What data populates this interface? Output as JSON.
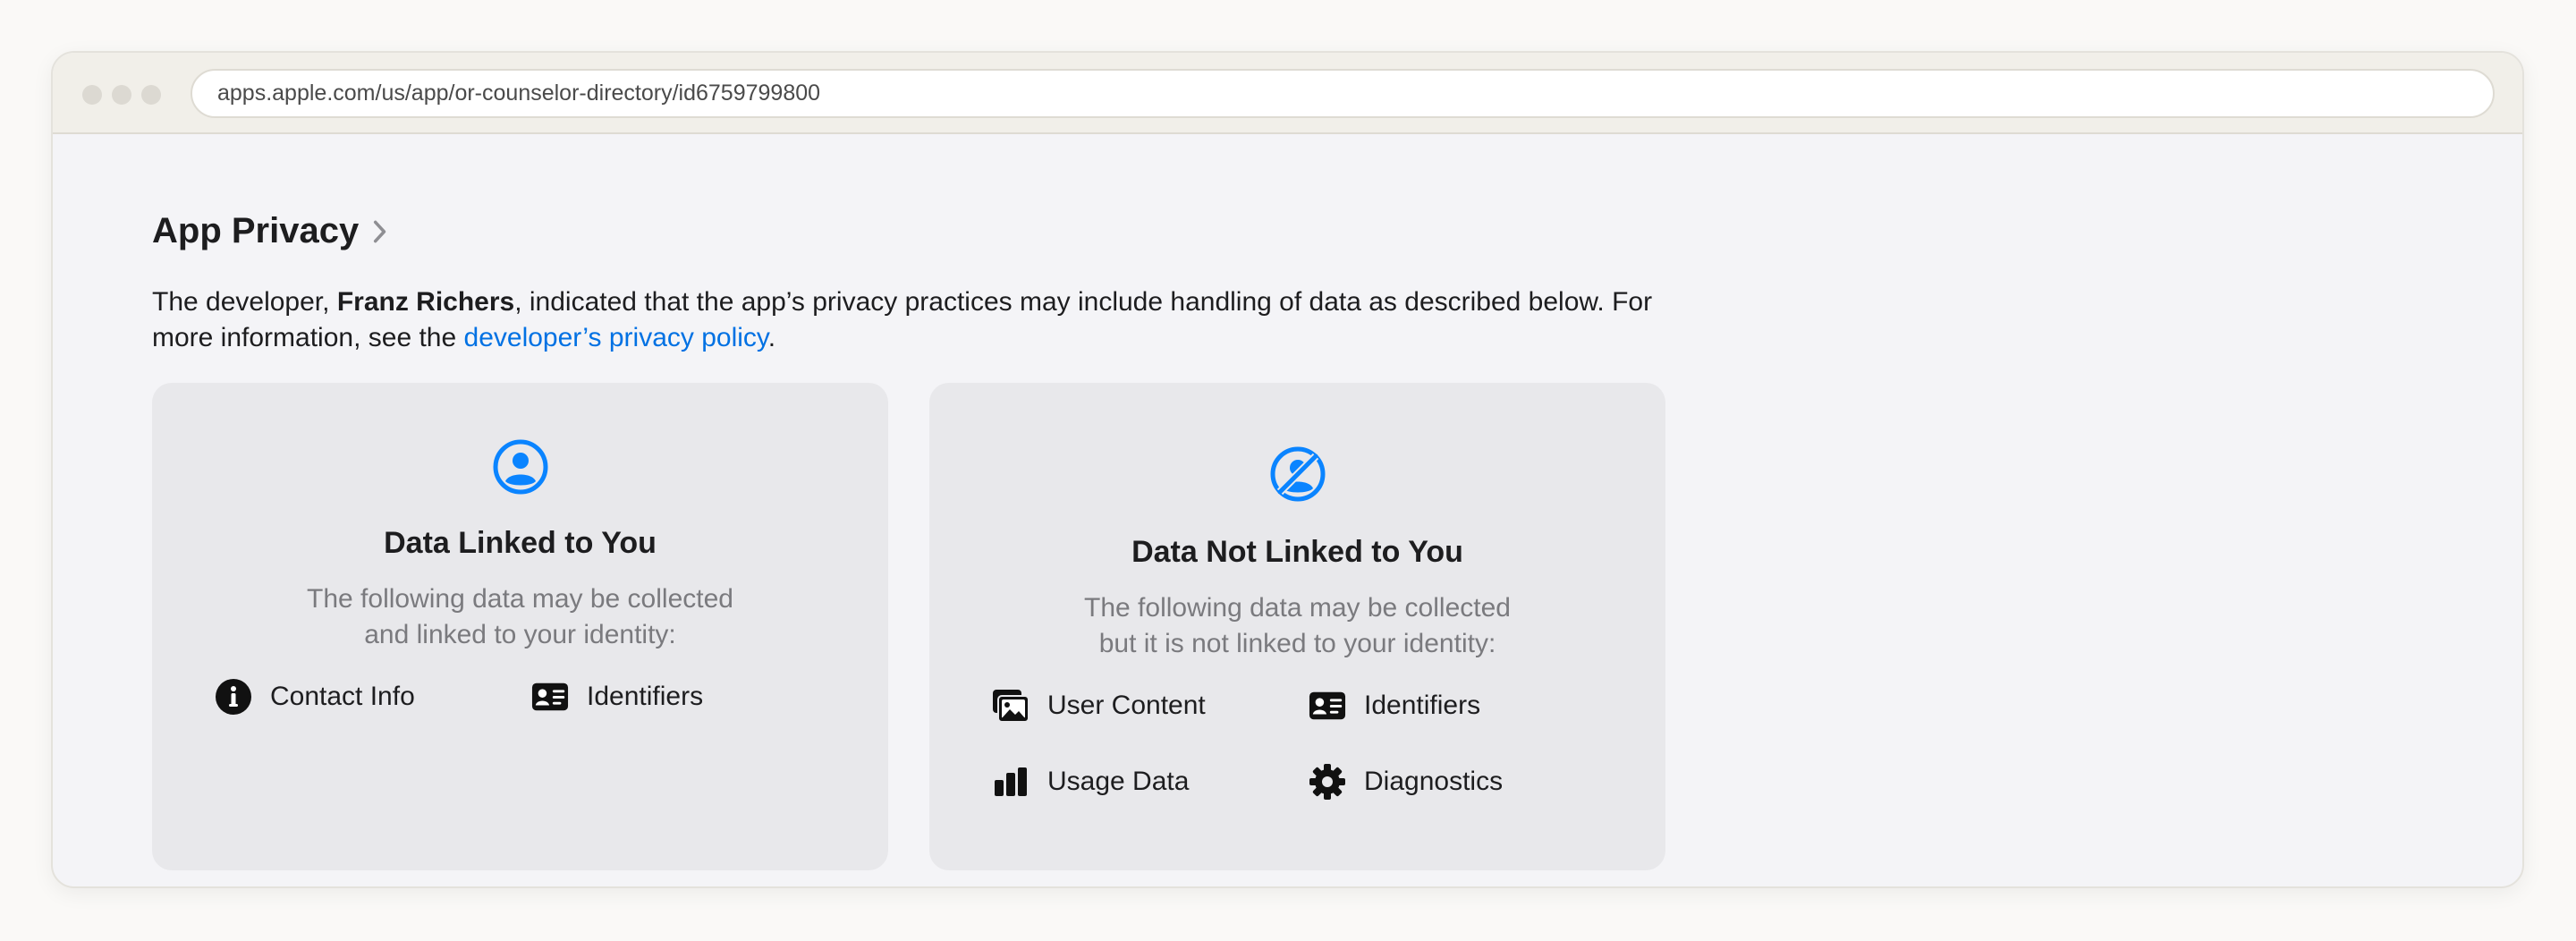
{
  "browser": {
    "url": "apps.apple.com/us/app/or-counselor-directory/id6759799800"
  },
  "privacy": {
    "title": "App Privacy",
    "desc_pre": "The developer, ",
    "developer": "Franz Richers",
    "desc_mid": ", indicated that the app’s privacy practices may include handling of data as described below. For more information, see the ",
    "policy_link": "developer’s privacy policy",
    "desc_post": "."
  },
  "cards": {
    "linked": {
      "icon": "person-circle-icon",
      "title": "Data Linked to You",
      "subtitle_line1": "The following data may be collected",
      "subtitle_line2": "and linked to your identity:",
      "items": [
        {
          "label": "Contact Info",
          "icon": "info-circle-icon"
        },
        {
          "label": "Identifiers",
          "icon": "id-card-icon"
        }
      ]
    },
    "not_linked": {
      "icon": "person-slash-circle-icon",
      "title": "Data Not Linked to You",
      "subtitle_line1": "The following data may be collected",
      "subtitle_line2": "but it is not linked to your identity:",
      "items": [
        {
          "label": "User Content",
          "icon": "photos-icon"
        },
        {
          "label": "Identifiers",
          "icon": "id-card-icon"
        },
        {
          "label": "Usage Data",
          "icon": "bar-chart-icon"
        },
        {
          "label": "Diagnostics",
          "icon": "gear-icon"
        }
      ]
    }
  },
  "colors": {
    "accent": "#0071e3",
    "icon_blue": "#0a84ff",
    "card_bg": "#e8e8eb",
    "text": "#1d1d1f",
    "muted": "#7a7a7e"
  }
}
